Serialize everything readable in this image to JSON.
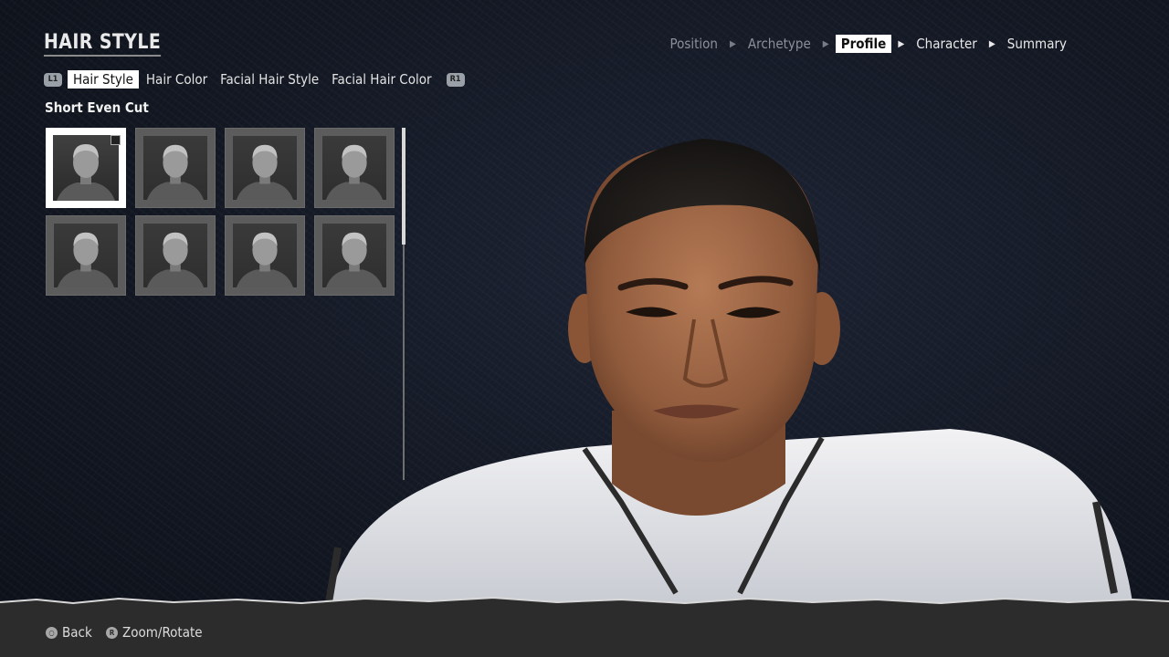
{
  "screen_title": "HAIR STYLE",
  "breadcrumb": {
    "steps": [
      "Position",
      "Archetype",
      "Profile",
      "Character",
      "Summary"
    ],
    "active_index": 2
  },
  "tabs": {
    "left_bumper": "L1",
    "right_bumper": "R1",
    "items": [
      "Hair Style",
      "Hair Color",
      "Facial Hair Style",
      "Facial Hair Color"
    ],
    "active_index": 0
  },
  "selected_style_name": "Short Even Cut",
  "hair_grid": {
    "count": 8,
    "selected_index": 0
  },
  "footer": {
    "back_icon": "circle-button-icon",
    "back_label": "Back",
    "zoom_icon": "R3-stick-icon",
    "zoom_icon_text": "R",
    "zoom_label": "Zoom/Rotate"
  },
  "colors": {
    "background": "#121722",
    "accent": "#ffffff",
    "inactive_text": "#8a8f98",
    "footer_bg": "#2c2c2c"
  }
}
